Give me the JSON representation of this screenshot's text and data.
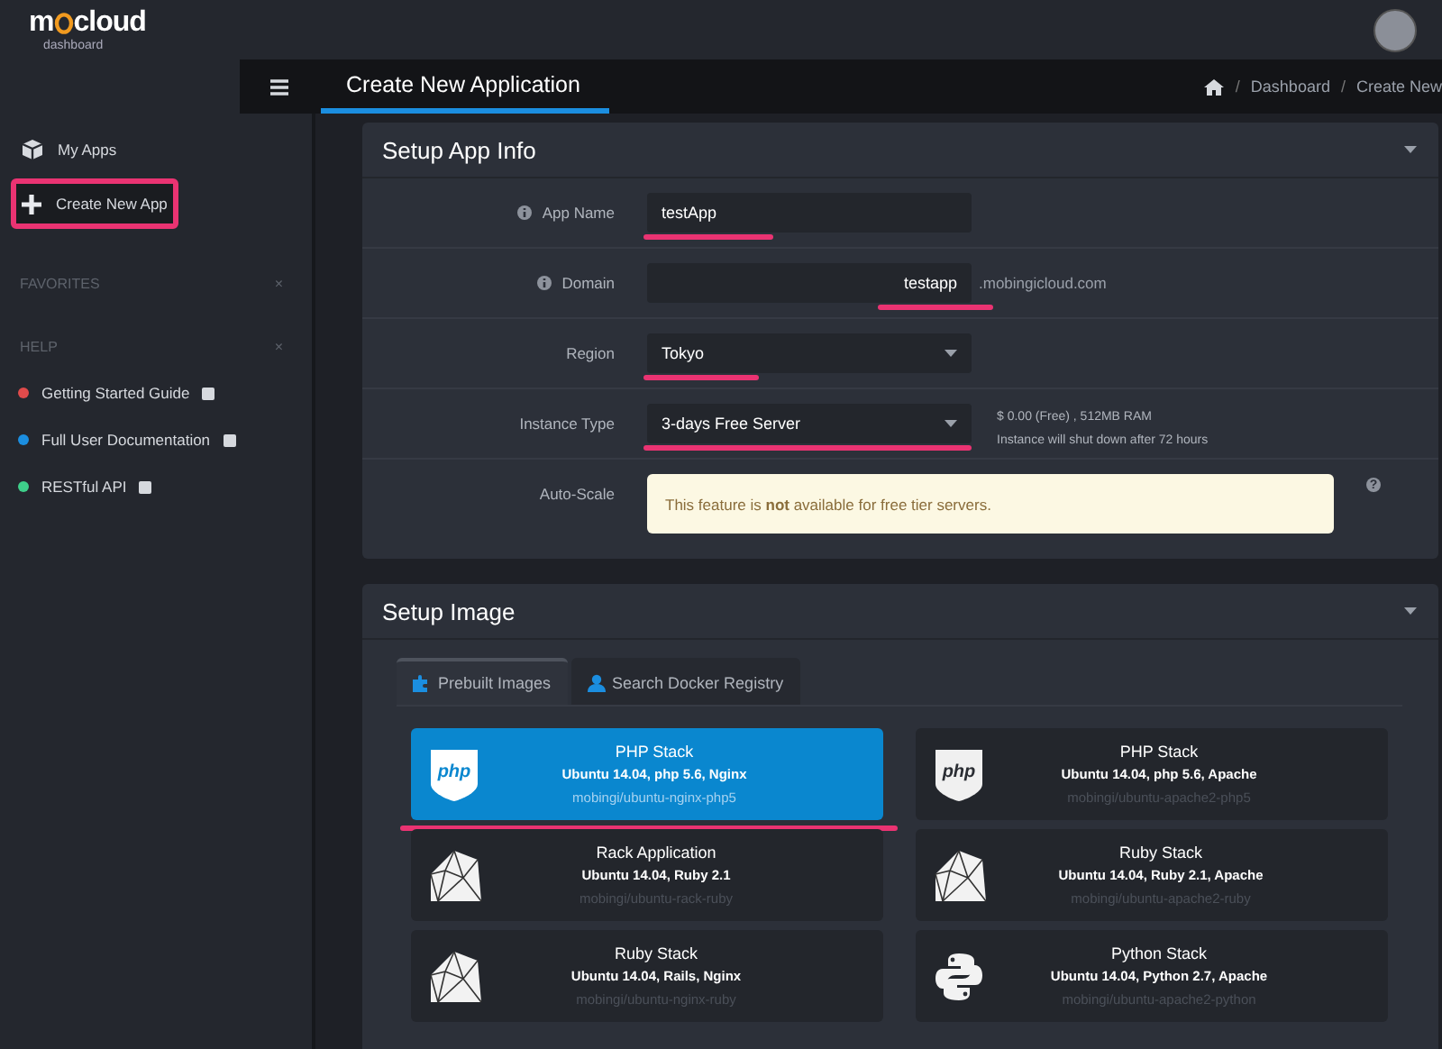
{
  "brand": {
    "name_start": "m",
    "name_end": "cloud",
    "subtitle": "dashboard"
  },
  "sidebar": {
    "items": [
      {
        "label": "My Apps",
        "annotated": false
      },
      {
        "label": "Create New App",
        "annotated": true
      }
    ],
    "sections": [
      {
        "title": "FAVORITES",
        "close": "×"
      },
      {
        "title": "HELP",
        "close": "×",
        "links": [
          {
            "label": "Getting Started Guide",
            "color": "#e04b4b"
          },
          {
            "label": "Full User Documentation",
            "color": "#1b8ee0"
          },
          {
            "label": "RESTful API",
            "color": "#3ecf8a"
          }
        ]
      }
    ]
  },
  "header": {
    "title": "Create New Application",
    "breadcrumb": [
      {
        "separator": "/",
        "label": "Dashboard"
      },
      {
        "separator": "/",
        "label": "Create New"
      }
    ]
  },
  "app_info": {
    "title": "Setup App Info",
    "fields": [
      {
        "kind": "text",
        "label": "App Name",
        "info": true,
        "value": "testApp",
        "annotated": true
      },
      {
        "kind": "domain",
        "label": "Domain",
        "info": true,
        "value": "testapp",
        "suffix": ".mobingicloud.com",
        "annotated": true
      },
      {
        "kind": "select",
        "label": "Region",
        "info": false,
        "value": "Tokyo",
        "annotated": true
      },
      {
        "kind": "select",
        "label": "Instance Type",
        "info": false,
        "value": "3-days Free Server",
        "notes": [
          "$ 0.00 (Free) , 512MB RAM",
          "Instance will shut down after 72 hours"
        ],
        "annotated": true
      },
      {
        "kind": "notice",
        "label": "Auto-Scale",
        "info": false,
        "text": "This feature is **not** available for free tier servers.",
        "help": "?",
        "annotated": false
      }
    ]
  },
  "setup_image": {
    "title": "Setup Image",
    "tabs": [
      {
        "label": "Prebuilt Images",
        "selected": true
      },
      {
        "label": "Search Docker Registry",
        "selected": false
      }
    ],
    "images": [
      {
        "kind": "php",
        "title": "PHP Stack",
        "subtitle": "Ubuntu 14.04, php 5.6, Nginx",
        "image": "mobingi/ubuntu-nginx-php5",
        "selected": true,
        "annotated": true
      },
      {
        "kind": "php",
        "title": "PHP Stack",
        "subtitle": "Ubuntu 14.04, php 5.6, Apache",
        "image": "mobingi/ubuntu-apache2-php5",
        "selected": false,
        "annotated": false
      },
      {
        "kind": "ruby",
        "title": "Rack Application",
        "subtitle": "Ubuntu 14.04, Ruby 2.1",
        "image": "mobingi/ubuntu-rack-ruby",
        "selected": false,
        "annotated": false
      },
      {
        "kind": "ruby",
        "title": "Ruby Stack",
        "subtitle": "Ubuntu 14.04, Ruby 2.1, Apache",
        "image": "mobingi/ubuntu-apache2-ruby",
        "selected": false,
        "annotated": false
      },
      {
        "kind": "ruby",
        "title": "Ruby Stack",
        "subtitle": "Ubuntu 14.04, Rails, Nginx",
        "image": "mobingi/ubuntu-nginx-ruby",
        "selected": false,
        "annotated": false
      },
      {
        "kind": "python",
        "title": "Python Stack",
        "subtitle": "Ubuntu 14.04, Python 2.7, Apache",
        "image": "mobingi/ubuntu-apache2-python",
        "selected": false,
        "annotated": false
      }
    ]
  }
}
